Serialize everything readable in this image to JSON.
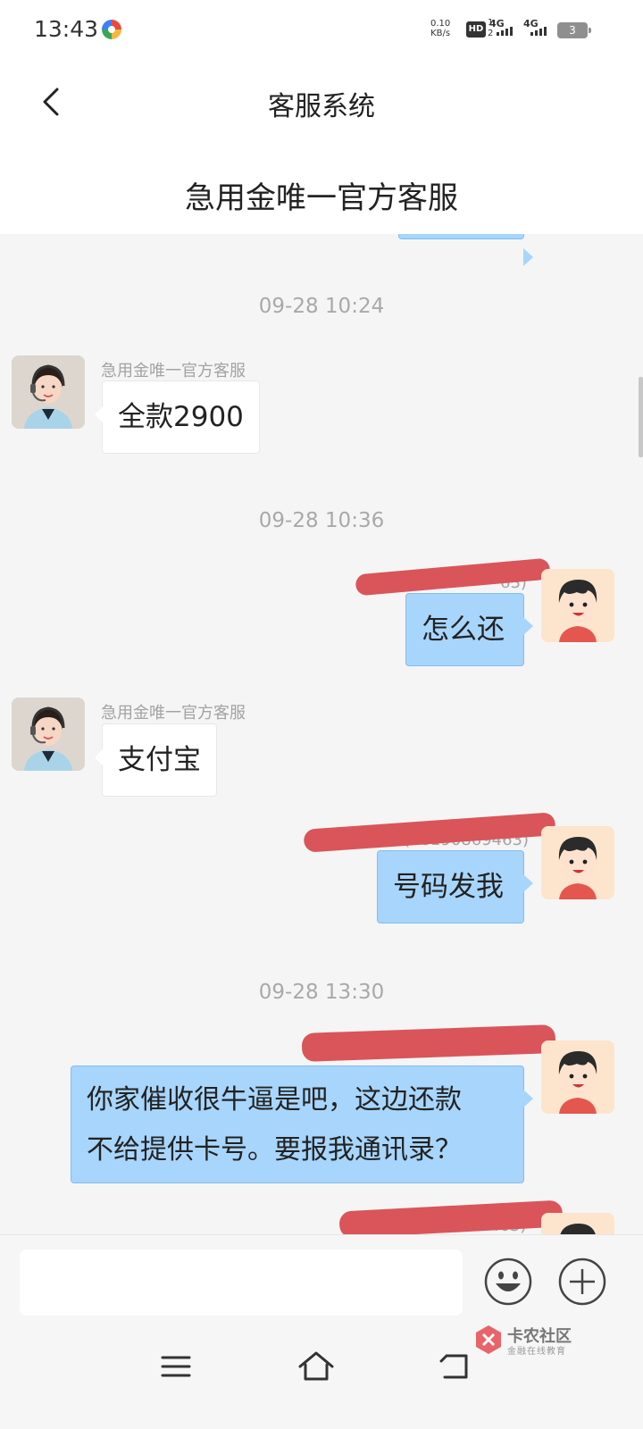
{
  "status_bar": {
    "time": "13:43",
    "net_speed_value": "0.10",
    "net_speed_unit": "KB/s",
    "hd_label": "HD",
    "sim1_label": "1",
    "sim2_label": "2",
    "signal1_label": "4G",
    "signal2_label": "4G",
    "battery": "3"
  },
  "header": {
    "title": "客服系统",
    "subtitle": "急用金唯一官方客服"
  },
  "messages": [
    {
      "type": "timestamp",
      "text": "09-28 10:24"
    },
    {
      "type": "agent",
      "sender": "急用金唯一官方客服",
      "text": "全款2900"
    },
    {
      "type": "timestamp",
      "text": "09-28 10:36"
    },
    {
      "type": "user",
      "sender_visible": "63)",
      "text": "怎么还"
    },
    {
      "type": "agent",
      "sender": "急用金唯一官方客服",
      "text": "支付宝"
    },
    {
      "type": "user",
      "sender_visible": "(18190869463)",
      "text": "号码发我"
    },
    {
      "type": "timestamp",
      "text": "09-28 13:30"
    },
    {
      "type": "user",
      "sender_visible": "",
      "text_line1": "你家催收很牛逼是吧，这边还款",
      "text_line2": "不给提供卡号。要报我通讯录？"
    },
    {
      "type": "user",
      "sender_visible": "463)",
      "text": ""
    }
  ],
  "input": {
    "placeholder": "",
    "value": ""
  },
  "icons": {
    "back": "back-arrow-icon",
    "emoji": "emoji-icon",
    "plus": "plus-icon",
    "menu": "menu-icon",
    "home": "home-icon",
    "return": "return-icon"
  },
  "watermark": {
    "title": "卡农社区",
    "subtitle": "金融在线教育"
  },
  "colors": {
    "user_bubble": "#a8d5fb",
    "agent_bubble": "#ffffff",
    "chat_bg": "#f5f5f5",
    "redaction": "#d9555a"
  }
}
